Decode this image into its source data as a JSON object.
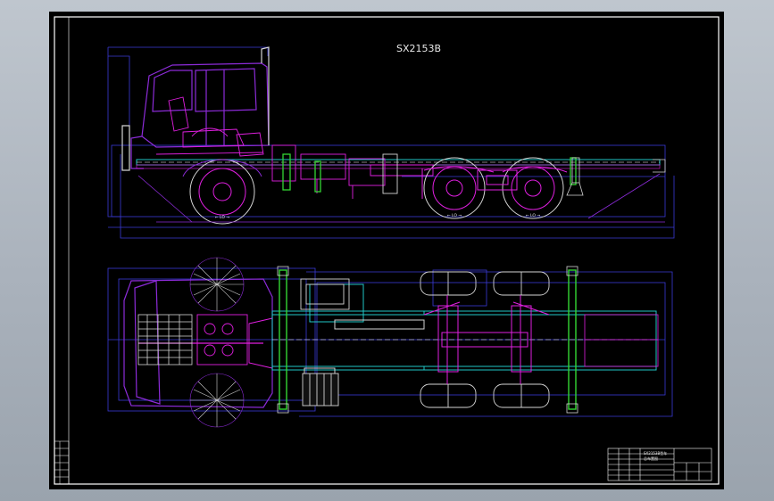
{
  "drawing": {
    "title": "SX2153B",
    "side_view_labels": [
      "← LO →",
      "← LO →",
      "← LO →"
    ],
    "title_block_text": [
      "SX2153B型车",
      "总布置图"
    ]
  },
  "colors": {
    "background": "#000000",
    "frame": "#ffffff",
    "body_outline": "#8c2bd8",
    "chassis": "#21c6c6",
    "detail": "#e01fe0",
    "guide": "#3a3ad6",
    "accent": "#33d633",
    "fill": "#d4d4d4"
  }
}
